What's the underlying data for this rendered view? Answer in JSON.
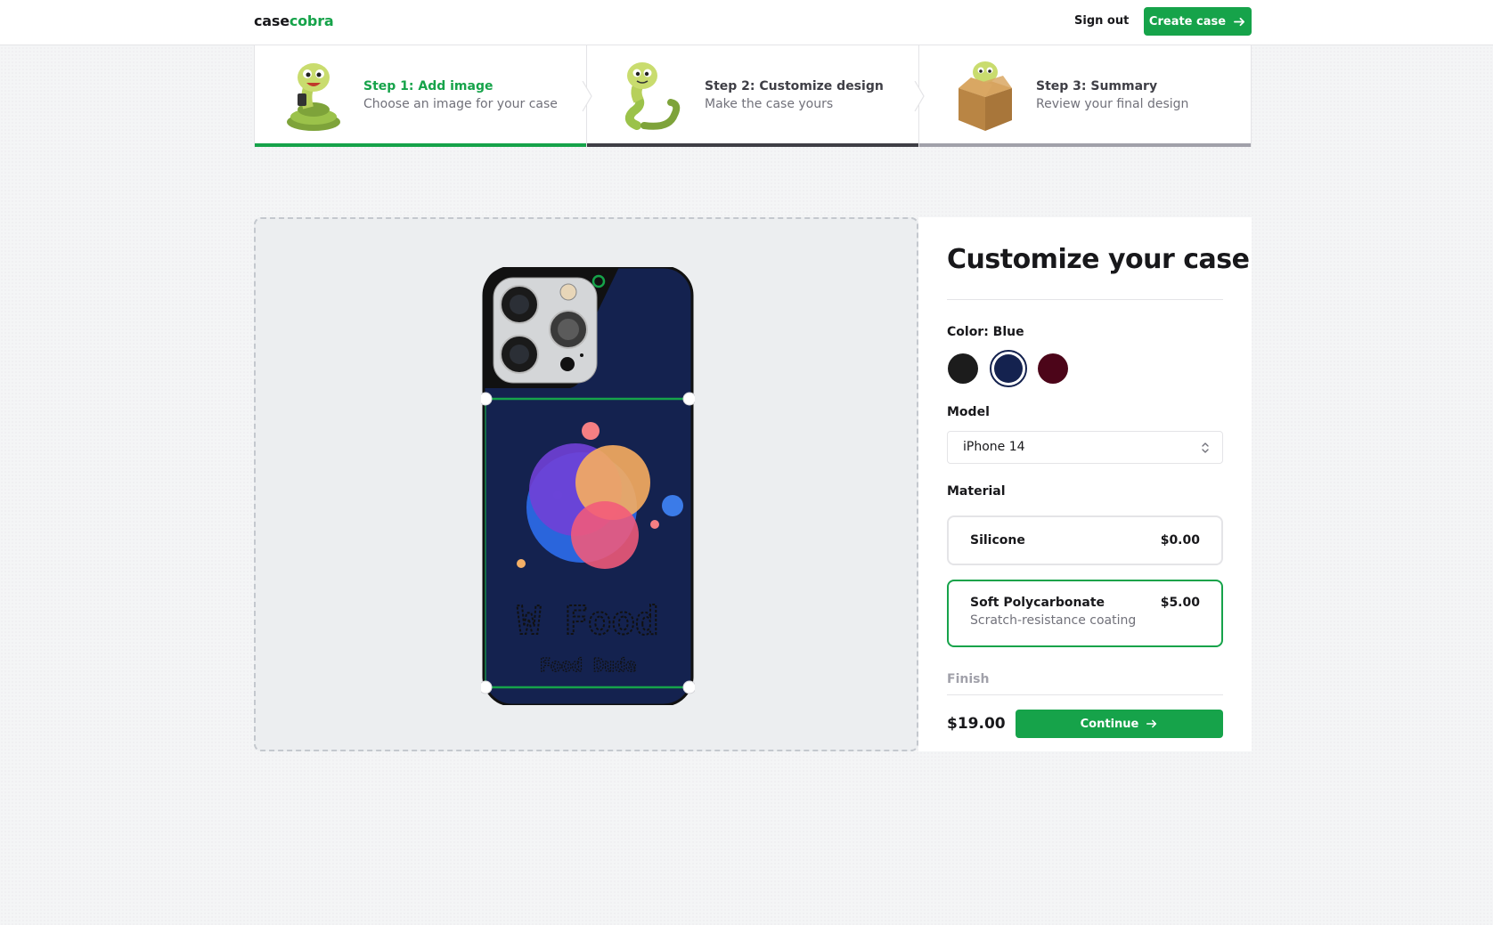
{
  "navbar": {
    "logo_part1": "case",
    "logo_part2": "cobra",
    "signout_label": "Sign out",
    "create_case_label": "Create case"
  },
  "steps": [
    {
      "title": "Step 1: Add image",
      "description": "Choose an image for your case",
      "status": "complete"
    },
    {
      "title": "Step 2: Customize design",
      "description": "Make the case yours",
      "status": "current"
    },
    {
      "title": "Step 3: Summary",
      "description": "Review your final design",
      "status": "upcoming"
    }
  ],
  "design": {
    "case_color": "#14224f",
    "artwork_title": "W Food",
    "artwork_subtitle": "Food Dude"
  },
  "panel": {
    "title": "Customize your case",
    "color_label": "Color: Blue",
    "colors": [
      {
        "name": "Black",
        "hex": "#1c1c1c",
        "selected": false
      },
      {
        "name": "Blue",
        "hex": "#14224f",
        "selected": true
      },
      {
        "name": "Rose",
        "hex": "#4c0519",
        "selected": false
      }
    ],
    "model_label": "Model",
    "model_value": "iPhone 14",
    "material_label": "Material",
    "materials": [
      {
        "name": "Silicone",
        "price": "$0.00",
        "description": "",
        "selected": false
      },
      {
        "name": "Soft Polycarbonate",
        "price": "$5.00",
        "description": "Scratch-resistance coating",
        "selected": true
      }
    ],
    "finish_label": "Finish",
    "total_price": "$19.00",
    "continue_label": "Continue"
  },
  "colors": {
    "accent": "#16a34a",
    "step2_bar": "#3f3f46",
    "step3_bar": "#a1a1aa"
  }
}
